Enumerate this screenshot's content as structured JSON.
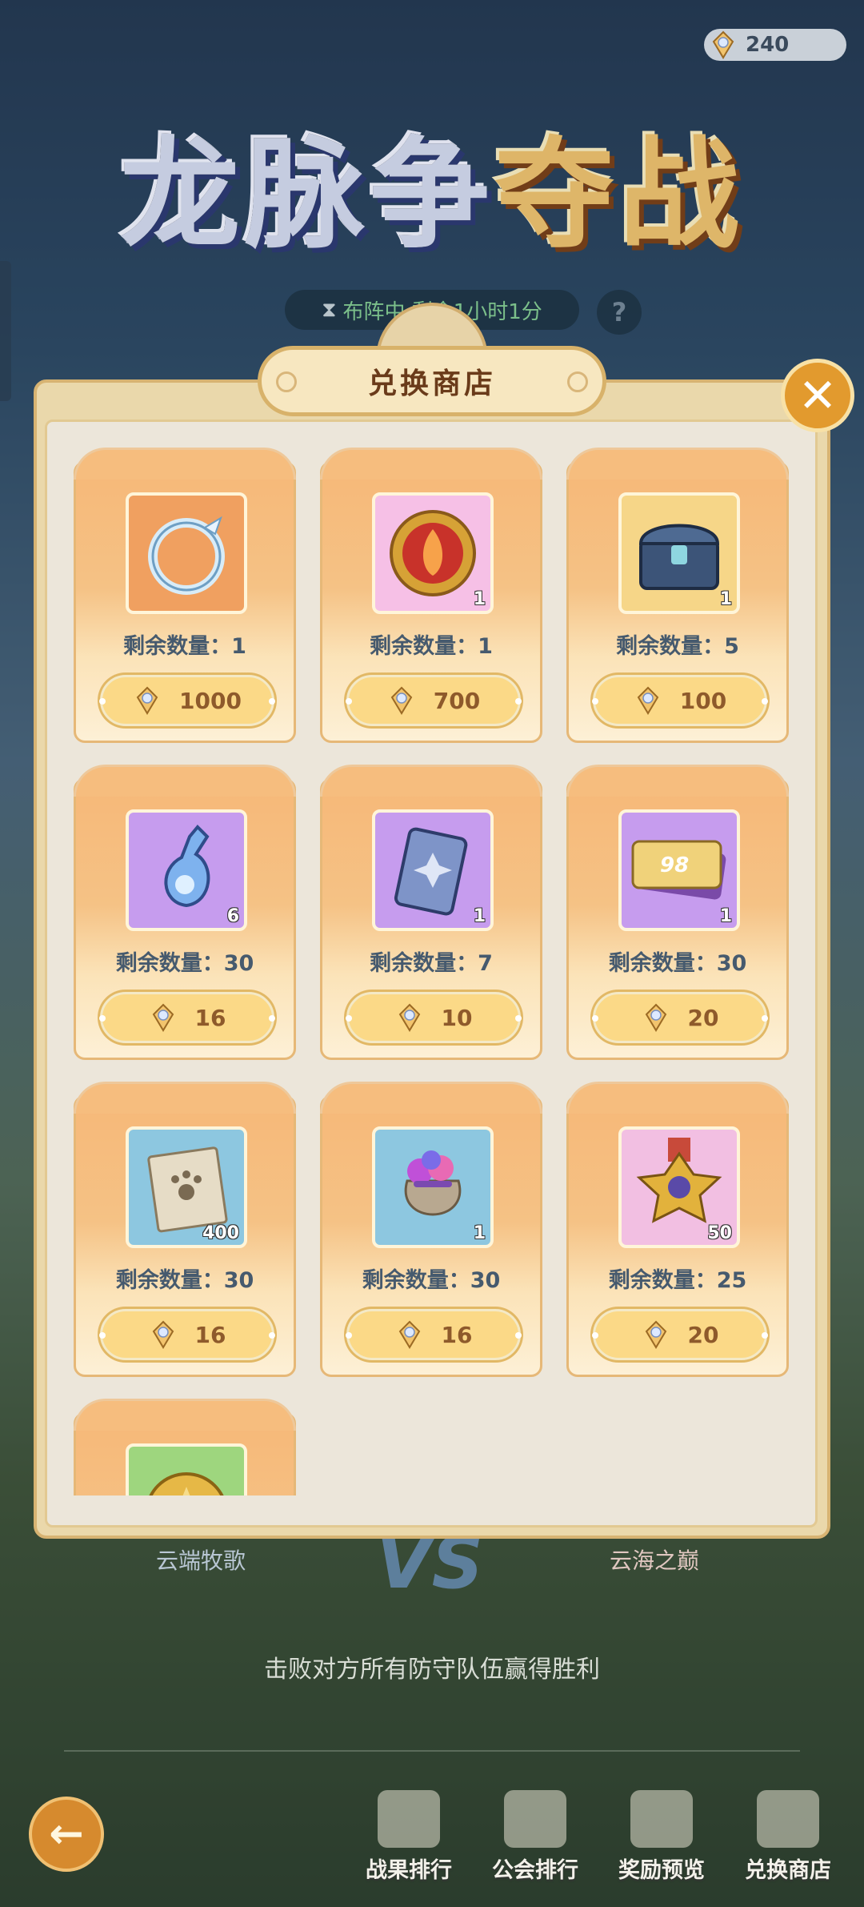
{
  "currency": {
    "amount": "240"
  },
  "event": {
    "title_cool": "龙脉争",
    "title_warm": "夺战",
    "timer_text": "布阵中 剩余1小时1分",
    "help_label": "?"
  },
  "battle": {
    "team_left": "云端牧歌",
    "team_right": "云海之巅",
    "vs_label": "VS",
    "win_hint": "击败对方所有防守队伍赢得胜利"
  },
  "shop": {
    "title": "兑换商店",
    "close_label": "✕",
    "remain_prefix": "剩余数量：",
    "items": [
      {
        "name": "dragon-ring",
        "remain": "剩余数量：1",
        "count": "",
        "price": "1000",
        "bg": "#f0a060"
      },
      {
        "name": "fire-emblem",
        "remain": "剩余数量：1",
        "count": "1",
        "price": "700",
        "bg": "#f6c0e6"
      },
      {
        "name": "treasure-chest",
        "remain": "剩余数量：5",
        "count": "1",
        "price": "100",
        "bg": "#f6d688"
      },
      {
        "name": "crystal-potion",
        "remain": "剩余数量：30",
        "count": "6",
        "price": "16",
        "bg": "#c69cee"
      },
      {
        "name": "rune-card",
        "remain": "剩余数量：7",
        "count": "1",
        "price": "10",
        "bg": "#c69cee"
      },
      {
        "name": "ticket-98",
        "remain": "剩余数量：30",
        "count": "1",
        "price": "20",
        "bg": "#c69cee"
      },
      {
        "name": "paw-scroll",
        "remain": "剩余数量：30",
        "count": "400",
        "price": "16",
        "bg": "#8dc7e0"
      },
      {
        "name": "gem-bag",
        "remain": "剩余数量：30",
        "count": "1",
        "price": "16",
        "bg": "#8dc7e0"
      },
      {
        "name": "star-medal",
        "remain": "剩余数量：25",
        "count": "50",
        "price": "20",
        "bg": "#f2bfe2"
      },
      {
        "name": "gold-coin",
        "remain": "",
        "count": "",
        "price": "",
        "bg": "#9ed67e"
      }
    ]
  },
  "nav": {
    "back_label": "←",
    "items": [
      {
        "label": "战果排行"
      },
      {
        "label": "公会排行"
      },
      {
        "label": "奖励预览"
      },
      {
        "label": "兑换商店"
      }
    ]
  }
}
